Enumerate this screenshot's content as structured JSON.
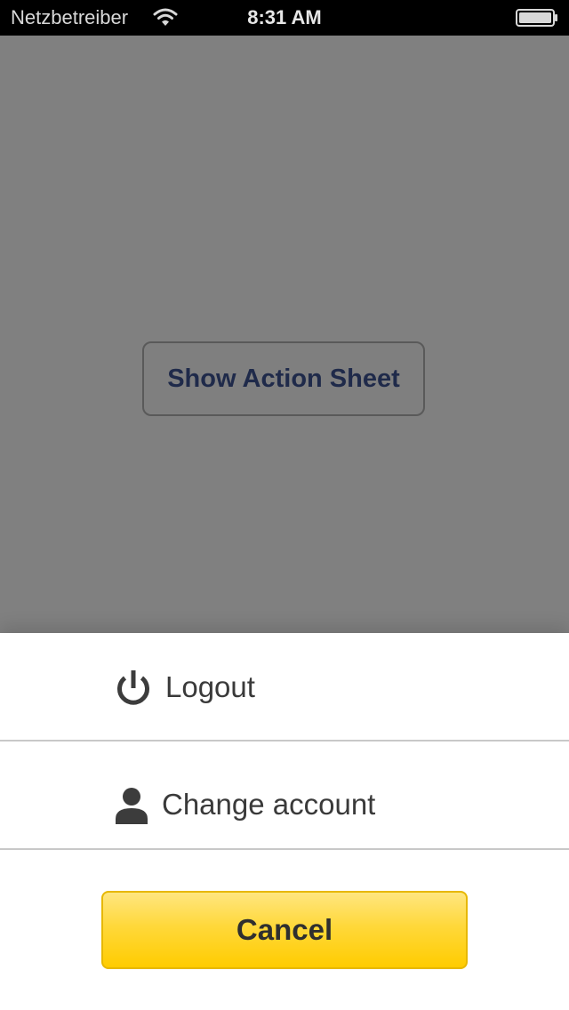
{
  "status_bar": {
    "carrier": "Netzbetreiber",
    "time": "8:31 AM",
    "icons": {
      "wifi": "wifi-icon",
      "battery": "battery-icon"
    }
  },
  "main": {
    "button_label": "Show Action Sheet"
  },
  "action_sheet": {
    "items": [
      {
        "label": "Logout",
        "icon": "power-icon"
      },
      {
        "label": "Change account",
        "icon": "user-icon"
      }
    ],
    "cancel_label": "Cancel"
  },
  "colors": {
    "overlay": "#808080",
    "sheet_background": "#ffffff",
    "cancel_button": "#ffcc00",
    "button_text": "#1f2a4a"
  }
}
